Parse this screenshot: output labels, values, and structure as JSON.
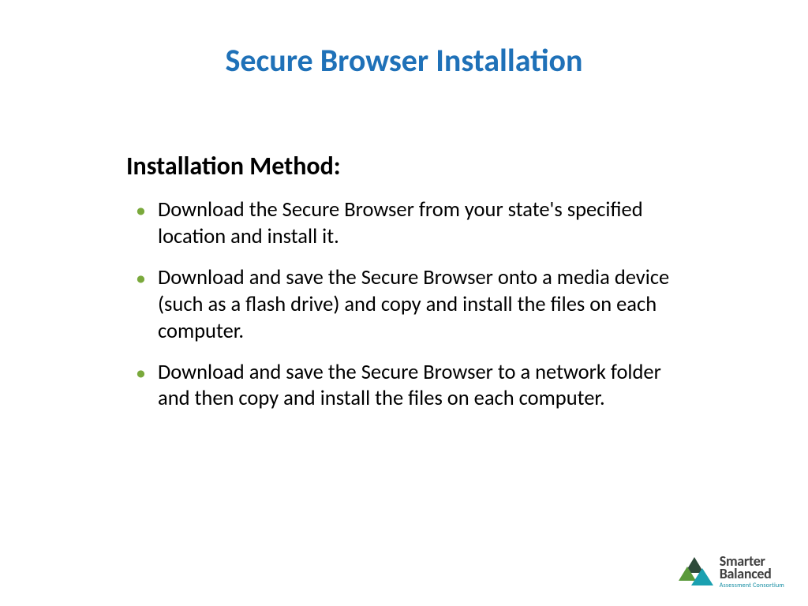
{
  "title": "Secure Browser Installation",
  "section_heading": "Installation Method:",
  "bullets": [
    "Download the Secure Browser from your state's specified location and install it.",
    "Download and save the Secure Browser onto a media device (such as a flash drive) and copy and install the files on each computer.",
    "Download and save the Secure Browser to a network folder and then copy and install the files on each computer."
  ],
  "logo": {
    "line1": "Smarter",
    "line2": "Balanced",
    "subtitle": "Assessment Consortium",
    "colors": {
      "tri_dark": "#2e4a3a",
      "tri_green": "#5a9a3a",
      "tri_teal": "#1aa0b0"
    }
  }
}
